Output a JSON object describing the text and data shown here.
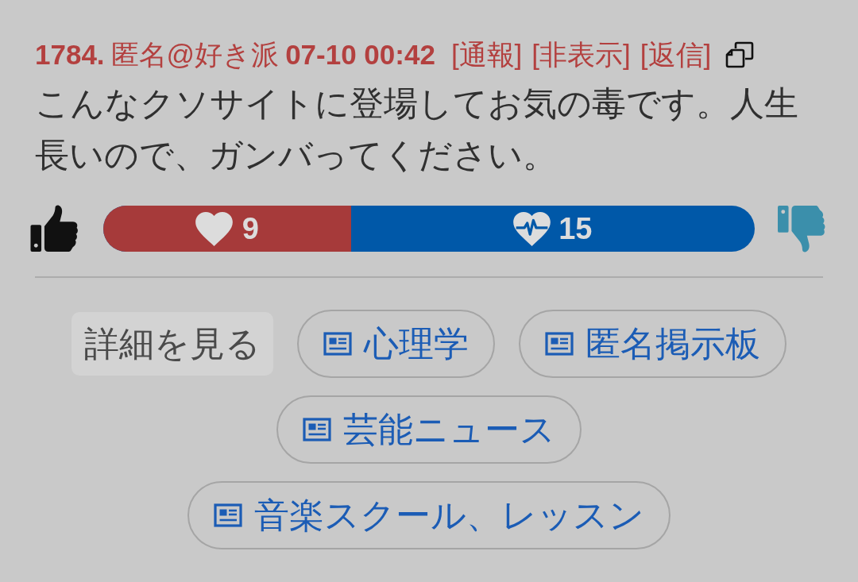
{
  "post": {
    "number": "1784.",
    "author": "匿名@好き派",
    "timestamp": "07-10 00:42",
    "actions": [
      "[通報]",
      "[非表示]",
      "[返信]"
    ],
    "body": "こんなクソサイトに登場してお気の毒です。人生長いので、ガンバってください。"
  },
  "votes": {
    "likes": "9",
    "dislikes": "15",
    "level": 0.38
  },
  "links": [
    {
      "kind": "details",
      "label": "詳細を見る"
    },
    {
      "kind": "tag",
      "label": "心理学"
    },
    {
      "kind": "tag",
      "label": "匿名掲示板"
    },
    {
      "kind": "tag",
      "label": "芸能ニュース"
    },
    {
      "kind": "tag",
      "label": "音楽スクール、レッスン"
    }
  ]
}
